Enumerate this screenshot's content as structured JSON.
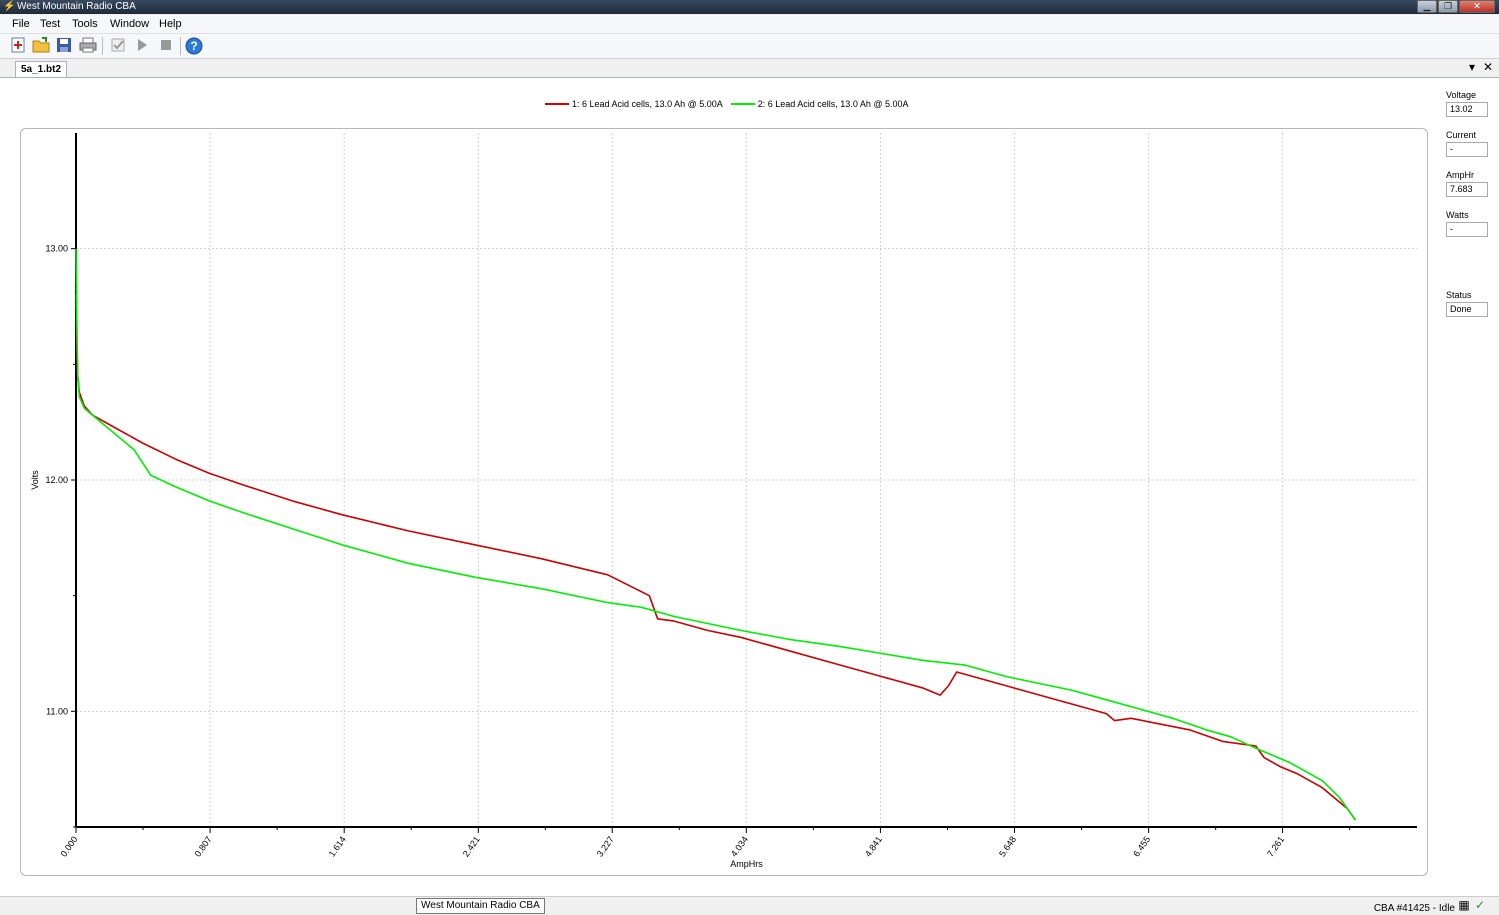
{
  "window": {
    "title": "West Mountain Radio CBA",
    "minimize": "▁",
    "restore": "❐",
    "close": "✕"
  },
  "menu": {
    "file": "File",
    "test": "Test",
    "tools": "Tools",
    "window": "Window",
    "help": "Help"
  },
  "toolbar": {
    "new_icon": "new-test-icon",
    "open_icon": "open-folder-icon",
    "save_icon": "save-icon",
    "print_icon": "print-icon",
    "check_icon": "check-icon",
    "play_icon": "play-icon",
    "stop_icon": "stop-icon",
    "help_icon": "help-icon"
  },
  "tab": {
    "label": "5a_1.bt2",
    "dropdown": "▾",
    "close": "✕"
  },
  "legend": [
    {
      "label": "1: 6 Lead Acid cells, 13.0 Ah @ 5.00A",
      "color": "#cc0000"
    },
    {
      "label": "2: 6 Lead Acid cells, 13.0 Ah @ 5.00A",
      "color": "#00ee00"
    }
  ],
  "readouts": {
    "voltage": {
      "label": "Voltage",
      "value": "13.02"
    },
    "current": {
      "label": "Current",
      "value": "-"
    },
    "amphr": {
      "label": "AmpHr",
      "value": "7.683"
    },
    "watts": {
      "label": "Watts",
      "value": "-"
    },
    "status": {
      "label": "Status",
      "value": "Done"
    }
  },
  "statusbar": {
    "tooltip": "West Mountain Radio CBA",
    "status": "CBA #41425 - Idle"
  },
  "chart_data": {
    "type": "line",
    "xlabel": "AmpHrs",
    "ylabel": "Volts",
    "xlim": [
      0,
      8.07
    ],
    "ylim": [
      10.5,
      13.5
    ],
    "grid": true,
    "legend_placement": "top-center",
    "x_ticks": [
      "0.000",
      "0.807",
      "1.614",
      "2.421",
      "3.227",
      "4.034",
      "4.841",
      "5.648",
      "6.455",
      "7.261"
    ],
    "y_ticks": [
      "11.00",
      "12.00",
      "13.00"
    ],
    "series": [
      {
        "name": "1: 6 Lead Acid cells, 13.0 Ah @ 5.00A",
        "color": "#cc0000",
        "x": [
          0,
          0.005,
          0.01,
          0.02,
          0.05,
          0.1,
          0.2,
          0.4,
          0.6,
          0.8,
          1.0,
          1.3,
          1.6,
          2.0,
          2.4,
          2.8,
          3.2,
          3.45,
          3.5,
          3.6,
          3.8,
          4.0,
          4.3,
          4.6,
          4.85,
          5.1,
          5.2,
          5.25,
          5.3,
          5.6,
          6.0,
          6.2,
          6.25,
          6.35,
          6.7,
          6.9,
          7.1,
          7.15,
          7.25,
          7.35,
          7.5,
          7.65,
          7.7
        ],
        "y": [
          12.8,
          12.6,
          12.45,
          12.38,
          12.32,
          12.28,
          12.24,
          12.16,
          12.09,
          12.03,
          11.98,
          11.91,
          11.85,
          11.78,
          11.72,
          11.66,
          11.59,
          11.5,
          11.4,
          11.39,
          11.35,
          11.32,
          11.26,
          11.2,
          11.15,
          11.1,
          11.07,
          11.11,
          11.17,
          11.11,
          11.03,
          10.99,
          10.96,
          10.97,
          10.92,
          10.87,
          10.85,
          10.8,
          10.76,
          10.73,
          10.67,
          10.58,
          10.53
        ]
      },
      {
        "name": "2: 6 Lead Acid cells, 13.0 Ah @ 5.00A",
        "color": "#00ee00",
        "x": [
          0,
          0.005,
          0.01,
          0.02,
          0.05,
          0.1,
          0.2,
          0.35,
          0.45,
          0.6,
          0.8,
          1.0,
          1.3,
          1.6,
          2.0,
          2.4,
          2.8,
          3.2,
          3.4,
          3.6,
          4.0,
          4.3,
          4.6,
          4.85,
          5.1,
          5.35,
          5.6,
          5.8,
          6.0,
          6.2,
          6.4,
          6.6,
          6.8,
          6.95,
          7.1,
          7.3,
          7.5,
          7.6,
          7.7
        ],
        "y": [
          13.0,
          12.7,
          12.45,
          12.36,
          12.31,
          12.28,
          12.22,
          12.13,
          12.02,
          11.97,
          11.91,
          11.86,
          11.79,
          11.72,
          11.64,
          11.58,
          11.53,
          11.47,
          11.45,
          11.41,
          11.35,
          11.31,
          11.28,
          11.25,
          11.22,
          11.2,
          11.15,
          11.12,
          11.09,
          11.05,
          11.01,
          10.97,
          10.92,
          10.89,
          10.84,
          10.78,
          10.7,
          10.63,
          10.53
        ]
      }
    ]
  }
}
